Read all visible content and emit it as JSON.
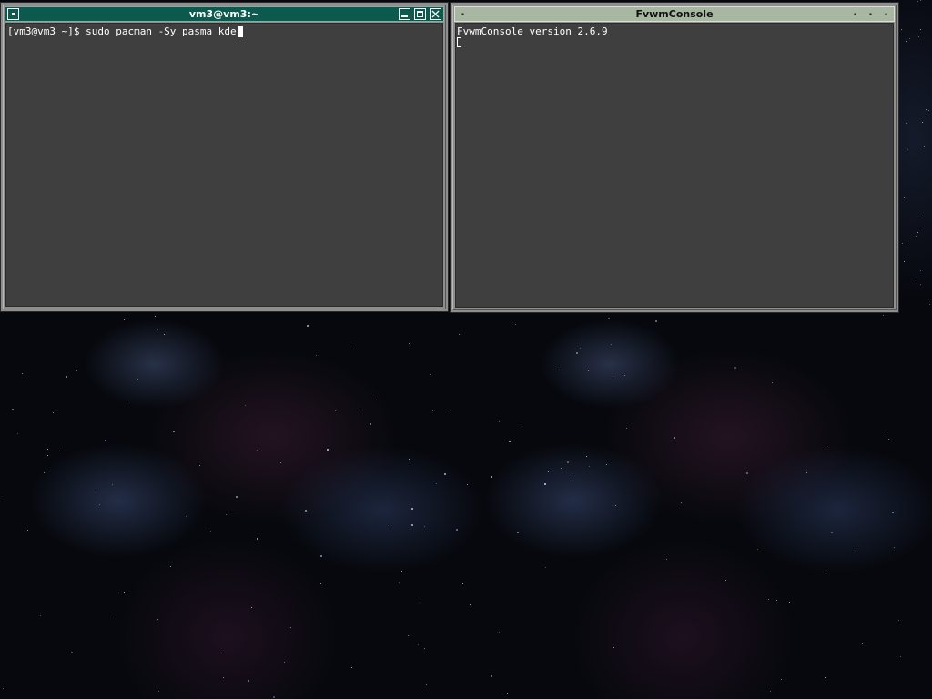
{
  "desktop": {
    "wallpaper": "starfield-nebula"
  },
  "terminal": {
    "title": "vm3@vm3:~",
    "icons": {
      "menu": "window-menu-icon",
      "minimize": "minimize-icon",
      "maximize": "maximize-icon",
      "close": "close-icon"
    },
    "prompt": "[vm3@vm3 ~]$ ",
    "command": "sudo pacman -Sy pasma kde",
    "title_bg": "#0c5a4e"
  },
  "console": {
    "title": "FvwmConsole",
    "version_line": "FvwmConsole version 2.6.9",
    "title_bg": "#a7b7a2"
  },
  "colors": {
    "client_bg": "#3f3f3f",
    "frame": "#8e8e8e",
    "text": "#ffffff"
  }
}
